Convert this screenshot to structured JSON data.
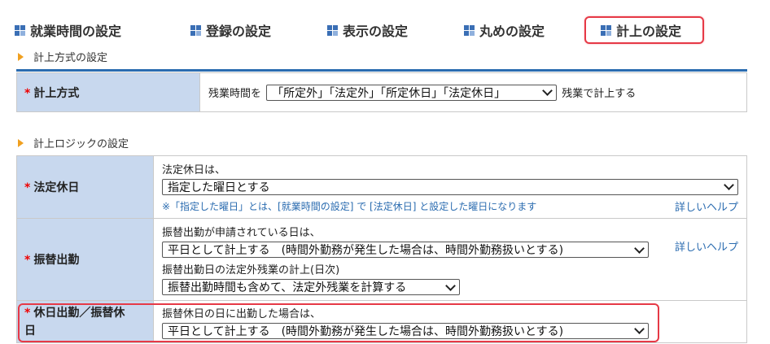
{
  "tabs": [
    {
      "label": "就業時間の設定"
    },
    {
      "label": "登録の設定"
    },
    {
      "label": "表示の設定"
    },
    {
      "label": "丸めの設定"
    },
    {
      "label": "計上の設定"
    }
  ],
  "section1": {
    "title": "計上方式の設定",
    "row": {
      "label": "計上方式",
      "prefix": "残業時間を",
      "select_value": "「所定外」「法定外」「所定休日」「法定休日」",
      "suffix": "残業で計上する"
    }
  },
  "section2": {
    "title": "計上ロジックの設定",
    "rows": {
      "legal_holiday": {
        "label": "法定休日",
        "desc": "法定休日は、",
        "select_value": "指定した曜日とする",
        "note": "※「指定した曜日」とは、[就業時間の設定] で [法定休日] と設定した曜日になります",
        "help": "詳しいヘルプ"
      },
      "substitute_work": {
        "label": "振替出勤",
        "desc1": "振替出勤が申請されている日は、",
        "select1_value": "平日として計上する　(時間外勤務が発生した場合は、時間外勤務扱いとする)",
        "help": "詳しいヘルプ",
        "desc2": "振替出勤日の法定外残業の計上(日次)",
        "select2_value": "振替出勤時間も含めて、法定外残業を計算する"
      },
      "holiday_work": {
        "label_line1": "休日出勤／振替休",
        "label_line2": "日",
        "desc": "振替休日の日に出勤した場合は、",
        "select_value": "平日として計上する　(時間外勤務が発生した場合は、時間外勤務扱いとする)"
      }
    }
  },
  "colors": {
    "accent": "#2b6cb0",
    "label_bg": "#c8d8ee",
    "highlight": "#e63946",
    "required": "#ee0000",
    "bullet": "#f0a020"
  }
}
